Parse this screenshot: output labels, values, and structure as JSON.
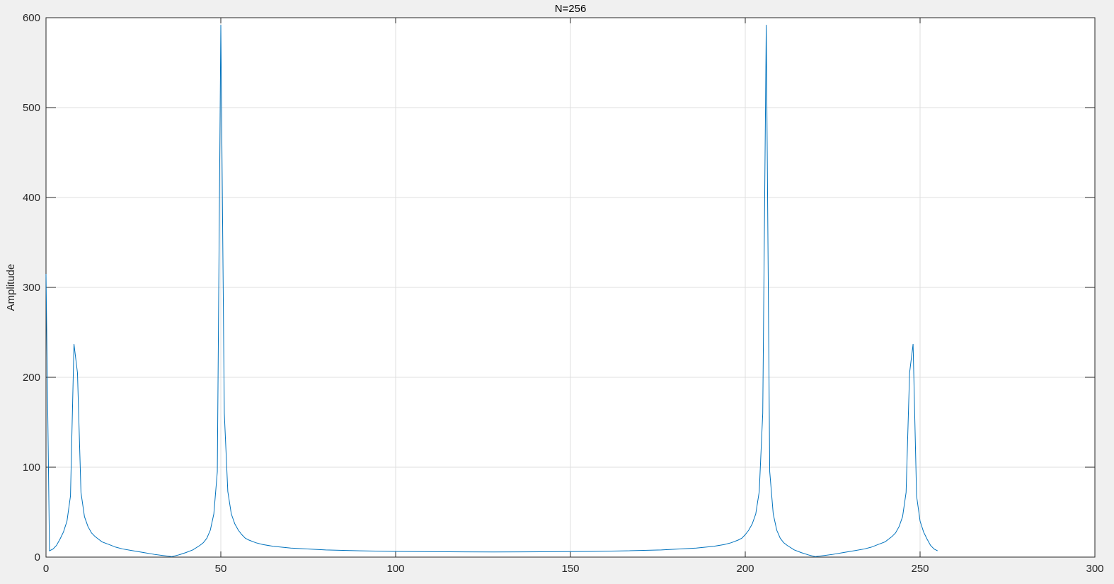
{
  "chart_data": {
    "type": "line",
    "title": "N=256",
    "xlabel": "",
    "ylabel": "Amplitude",
    "xlim": [
      0,
      300
    ],
    "ylim": [
      0,
      600
    ],
    "xticks": [
      0,
      50,
      100,
      150,
      200,
      250,
      300
    ],
    "xtick_labels": [
      "0",
      "50",
      "100",
      "150",
      "200",
      "250",
      "300"
    ],
    "yticks": [
      0,
      100,
      200,
      300,
      400,
      500,
      600
    ],
    "ytick_labels": [
      "0",
      "100",
      "200",
      "300",
      "400",
      "500",
      "600"
    ],
    "grid": true,
    "line_color": "#0072bd",
    "series": [
      {
        "x": [
          0,
          1,
          2,
          3,
          4,
          5,
          6,
          7,
          8,
          9,
          10,
          11,
          12,
          13,
          14,
          15,
          16,
          18,
          20,
          22,
          25,
          28,
          31,
          34,
          36,
          38,
          40,
          42,
          44,
          45,
          46,
          47,
          48,
          49,
          50,
          51,
          52,
          53,
          54,
          55,
          56,
          57,
          58,
          60,
          62,
          65,
          70,
          80,
          90,
          100,
          110,
          120,
          128,
          136,
          146,
          156,
          166,
          176,
          186,
          191,
          194,
          196,
          198,
          199,
          200,
          201,
          202,
          203,
          204,
          205,
          206,
          207,
          208,
          209,
          210,
          211,
          212,
          214,
          216,
          218,
          220,
          222,
          225,
          228,
          231,
          234,
          236,
          238,
          240,
          241,
          242,
          243,
          244,
          245,
          246,
          247,
          248,
          249,
          250,
          251,
          252,
          253,
          254,
          255
        ],
        "y": [
          315,
          7,
          9,
          13,
          20,
          28,
          40,
          68,
          237,
          205,
          72,
          45,
          34,
          27,
          23,
          20,
          17,
          14,
          11,
          9,
          7,
          5,
          3,
          1.5,
          0.5,
          2.5,
          5,
          8,
          13,
          16,
          21,
          30,
          48,
          95,
          592,
          160,
          73,
          48,
          37,
          30,
          25,
          21,
          19,
          16,
          14,
          12,
          10,
          8,
          7,
          6.3,
          6,
          5.8,
          5.7,
          5.8,
          6,
          6.3,
          7,
          8,
          10,
          12,
          14,
          16,
          19,
          21,
          25,
          30,
          37,
          48,
          73,
          160,
          592,
          95,
          48,
          30,
          21,
          16,
          13,
          8,
          5,
          2.5,
          0.5,
          1.5,
          3,
          5,
          7,
          9,
          11,
          14,
          17,
          20,
          23,
          27,
          34,
          45,
          72,
          205,
          237,
          68,
          40,
          28,
          20,
          13,
          9,
          7
        ]
      }
    ]
  }
}
